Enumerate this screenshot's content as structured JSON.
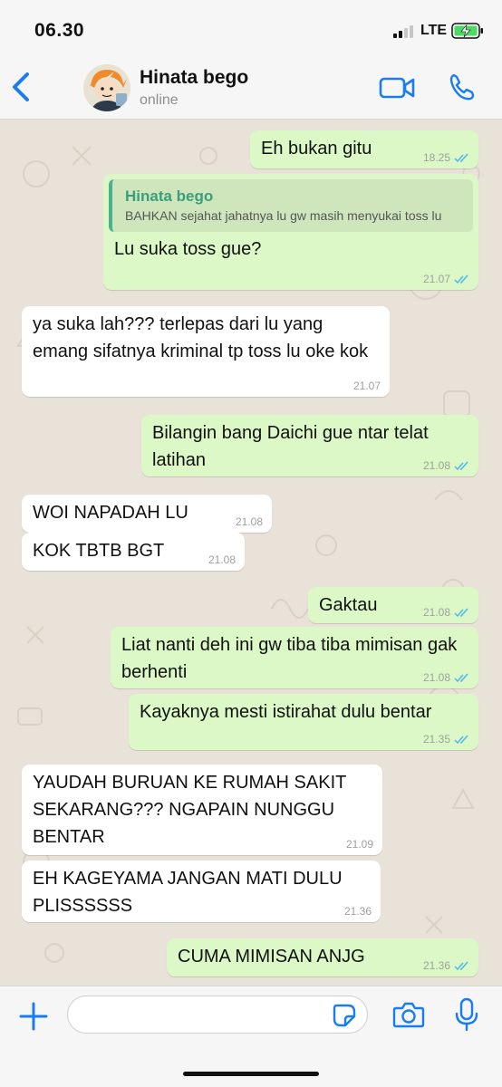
{
  "status_bar": {
    "time": "06.30",
    "network": "LTE"
  },
  "header": {
    "name": "Hinata bego",
    "status": "online"
  },
  "messages": [
    {
      "dir": "out",
      "text": "Eh bukan gitu",
      "time": "18.25"
    },
    {
      "dir": "out",
      "quote_name": "Hinata bego",
      "quote_text": "BAHKAN sejahat jahatnya lu gw masih menyukai toss lu",
      "text": "Lu suka toss gue?",
      "time": "21.07"
    },
    {
      "dir": "in",
      "text": "ya suka lah??? terlepas dari lu yang emang sifatnya kriminal tp toss lu oke kok",
      "time": "21.07"
    },
    {
      "dir": "out",
      "text": "Bilangin bang Daichi gue ntar telat latihan",
      "time": "21.08"
    },
    {
      "dir": "in",
      "text": "WOI NAPADAH LU",
      "time": "21.08"
    },
    {
      "dir": "in",
      "text": "KOK TBTB BGT",
      "time": "21.08"
    },
    {
      "dir": "out",
      "text": "Gaktau",
      "time": "21.08"
    },
    {
      "dir": "out",
      "text": "Liat nanti deh ini gw tiba tiba mimisan gak berhenti",
      "time": "21.08"
    },
    {
      "dir": "out",
      "text": "Kayaknya mesti istirahat dulu bentar",
      "time": "21.35"
    },
    {
      "dir": "in",
      "text": "YAUDAH BURUAN KE RUMAH SAKIT SEKARANG??? NGAPAIN NUNGGU BENTAR",
      "time": "21.09"
    },
    {
      "dir": "in",
      "text": "EH KAGEYAMA JANGAN MATI DULU PLISSSSSS",
      "time": "21.36"
    },
    {
      "dir": "out",
      "text": "CUMA MIMISAN ANJG",
      "time": "21.36"
    }
  ],
  "input": {
    "value": "",
    "placeholder": ""
  },
  "icons": {
    "back": "chevron-left-icon",
    "video": "video-camera-icon",
    "call": "phone-icon",
    "plus": "plus-icon",
    "sticker": "sticker-icon",
    "camera": "camera-icon",
    "mic": "microphone-icon",
    "read": "double-check-icon"
  },
  "colors": {
    "accent": "#1a7cf5",
    "outgoing_bubble": "#dcf8c6",
    "incoming_bubble": "#ffffff",
    "read_ticks": "#4fb6ec",
    "chat_background": "#e9e2d9"
  }
}
